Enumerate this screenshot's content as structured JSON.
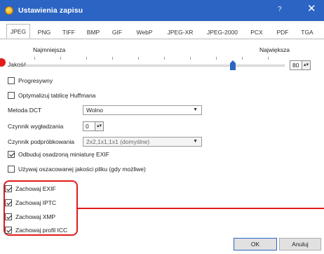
{
  "window": {
    "title": "Ustawienia zapisu",
    "help_glyph": "?",
    "close_glyph": "✕"
  },
  "tabs": [
    {
      "label": "JPEG",
      "active": true
    },
    {
      "label": "PNG"
    },
    {
      "label": "TIFF"
    },
    {
      "label": "BMP"
    },
    {
      "label": "GIF"
    },
    {
      "label": "WebP"
    },
    {
      "label": "JPEG-XR"
    },
    {
      "label": "JPEG-2000"
    },
    {
      "label": "PCX"
    },
    {
      "label": "PDF"
    },
    {
      "label": "TGA"
    }
  ],
  "quality": {
    "label": "Jakość",
    "min_label": "Najmniejsza",
    "max_label": "Największa",
    "value": "80",
    "slider_min": 0,
    "slider_max": 100,
    "slider_value": 80
  },
  "options": {
    "progressive": {
      "label": "Progresywny",
      "checked": false
    },
    "optimize_huffman": {
      "label": "Optymalizuj tablicę Huffmana",
      "checked": false
    },
    "dct": {
      "label": "Metoda DCT",
      "value": "Wolno"
    },
    "smoothing": {
      "label": "Czynnik wygładzania",
      "value": "0"
    },
    "subsampling": {
      "label": "Czynnik podpróbkowania",
      "value": "2x2,1x1,1x1 (domyślne)"
    },
    "rebuild_exif_thumb": {
      "label": "Odbuduj osadzoną miniaturę EXIF",
      "checked": true
    },
    "use_estimated_quality": {
      "label": "Używaj oszacowanej jakości pliku (gdy możliwe)",
      "checked": false
    }
  },
  "keep_metadata": [
    {
      "label": "Zachowaj EXIF",
      "checked": true
    },
    {
      "label": "Zachowaj IPTC",
      "checked": true
    },
    {
      "label": "Zachowaj XMP",
      "checked": true
    },
    {
      "label": "Zachowaj profil ICC",
      "checked": true
    }
  ],
  "buttons": {
    "ok": "OK",
    "cancel": "Anuluj"
  },
  "colors": {
    "titlebar": "#2b64c3",
    "highlight": "#e21b1b"
  },
  "icons": {
    "dropdown": "chevron-down-icon",
    "spinner": "spin-updown-icon",
    "app": "app-icon"
  }
}
